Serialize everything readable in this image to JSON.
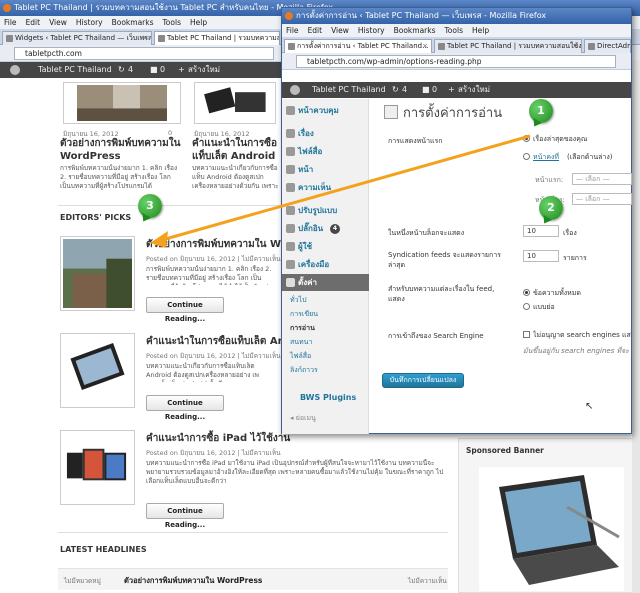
{
  "back": {
    "title": "Tablet PC Thailand | รวมบทความสอนใช้งาน Tablet PC สำหรับคนไทย - Mozilla Firefox",
    "menu": [
      "File",
      "Edit",
      "View",
      "History",
      "Bookmarks",
      "Tools",
      "Help"
    ],
    "tabs": [
      "Widgets ‹ Tablet PC Thailand — เว็บเพรส",
      "Tablet PC Thailand | รวมบทความสอนใช้งาน..."
    ],
    "url": "tabletpcth.com",
    "admin": {
      "site": "Tablet PC Thailand",
      "updates": "4",
      "comments": "0",
      "new": "สร้างใหม่"
    },
    "top_posts": [
      {
        "meta": "มิถุนายน 16, 2012",
        "comments": "0",
        "title": "ตัวอย่างการพิมพ์บทความใน WordPress",
        "excerpt": "การพิมพ์บทความนั้นง่ายมาก 1. คลิก เรื่อง 2. รายชื่อบทความที่มีอยู่ สร้างเรื่อง โลก เป็นบทความที่ผู้สร้างโปรแกรมได้"
      },
      {
        "meta": "มิถุนายน 16, 2012",
        "comments": "0",
        "title": "คำแนะนำในการซื้อแท็บเล็ต Android",
        "excerpt": "บทความแนะนำเกี่ยวกับการซื้อแท็บ Android ต้องดูสเปกเครื่องหลายอย่างด้วยกัน เพราะเหมาะกับ"
      }
    ],
    "editors_picks": "EDITORS' PICKS",
    "picks": [
      {
        "title": "ตัวอย่างการพิมพ์บทความใน WordPress",
        "meta": "Posted on มิถุนายน 16, 2012  | ไม่มีความเห็น",
        "excerpt": "การพิมพ์บทความนั้นง่ายมาก 1. คลิก เรื่อง 2. รายชื่อบทความที่มีอยู่ สร้างเรื่อง โลก เป็นบทความที่ผู้สร้างโปรแกรมได้ทำไว้เป็นตัวอย่างการพิมพ์",
        "button": "Continue Reading..."
      },
      {
        "title": "คำแนะนำในการซื้อแท็บเล็ต Android",
        "meta": "Posted on มิถุนายน 16, 2012  | ไม่มีความเห็น",
        "excerpt": "บทความแนะนำเกี่ยวกับการซื้อแท็บเล็ต Android ต้องดูสเปกเครื่องหลายอย่าง เพราะแท็บเล็ต Android นั้นมีหลากหลายมาก หลายรุ่น",
        "button": "Continue Reading..."
      },
      {
        "title": "คำแนะนำการซื้อ iPad ไว้ใช้งาน",
        "meta": "Posted on มิถุนายน 16, 2012  | ไม่มีความเห็น",
        "excerpt": "บทความแนะนำการซื้อ iPad มาใช้งาน iPad เป็นอุปกรณ์สำหรับผู้ที่สนใจจะหามาไว้ใช้งาน บทความนี้จะพยายามรวบรวมข้อมูลมาอ้างอิงให้ละเอียดที่สุด เพราะหลายคนซื้อมาแล้วใช้งานไม่คุ้ม ในขณะที่ราคาถูก ไปเลือกแท็บเล็ตแบบอื่นจะดีกว่า",
        "button": "Continue Reading..."
      }
    ],
    "latest_headlines": "LATEST HEADLINES",
    "latest_row": {
      "left": "ไม่มีหมวดหมู่",
      "title": "ตัวอย่างการพิมพ์บทความใน WordPress",
      "right": "ไม่มีความเห็น"
    },
    "sponsored": "Sponsored Banner"
  },
  "front": {
    "title": "การตั้งค่าการอ่าน ‹ Tablet PC Thailand — เว็บเพรส - Mozilla Firefox",
    "menu": [
      "File",
      "Edit",
      "View",
      "History",
      "Bookmarks",
      "Tools",
      "Help"
    ],
    "tabs": [
      "การตั้งค่าการอ่าน ‹ Tablet PC Thailand...",
      "Tablet PC Thailand | รวมบทความสอนใช้งาน...",
      "DirectAdmin"
    ],
    "url": "tabletpcth.com/wp-admin/options-reading.php",
    "admin": {
      "site": "Tablet PC Thailand",
      "updates": "4",
      "comments": "0",
      "new": "สร้างใหม่"
    },
    "sidebar": [
      "หน้าควบคุม",
      "เรื่อง",
      "ไฟล์สื่อ",
      "หน้า",
      "ความเห็น",
      "ปรับรูปแบบ",
      "ปลั๊กอิน",
      "ผู้ใช้",
      "เครื่องมือ",
      "ตั้งค่า"
    ],
    "plugin_count": "4",
    "submenu": [
      "ทั่วไป",
      "การเขียน",
      "การอ่าน",
      "สนทนา",
      "ไฟล์สื่อ",
      "ลิงก์ถาวร"
    ],
    "bws": "BWS Plugins",
    "collapse": "ย่อเมนู",
    "page_title": "การตั้งค่าการอ่าน",
    "front_display_label": "การแสดงหน้าแรก",
    "opt_latest": "เรื่องล่าสุดของคุณ",
    "opt_static": "หน้าคงที่",
    "opt_static_note": "(เลือกด้านล่าง)",
    "front_page_label": "หน้าแรก:",
    "posts_page_label": "หน้าเรื่อง:",
    "select_placeholder": "— เลือก —",
    "blog_pages_label": "ในหนึ่งหน้าบล็อกจะแสดง",
    "blog_pages_value": "10",
    "blog_pages_unit": "เรื่อง",
    "feeds_label": "Syndication feeds จะแสดงรายการล่าสุด",
    "feeds_value": "10",
    "feeds_unit": "รายการ",
    "feed_show_label": "สำหรับบทความแต่ละเรื่องใน feed, แสดง",
    "feed_full": "ข้อความทั้งหมด",
    "feed_summary": "แบบย่อ",
    "search_label": "การเข้าถึงของ Search Engine",
    "search_check": "ไม่อนุญาต search engines แสดง",
    "search_note": "มันขึ้นอยู่กับ search engines ที่จะ",
    "save_button": "บันทึกการเปลี่ยนแปลง"
  },
  "callouts": [
    "1",
    "2",
    "3"
  ]
}
